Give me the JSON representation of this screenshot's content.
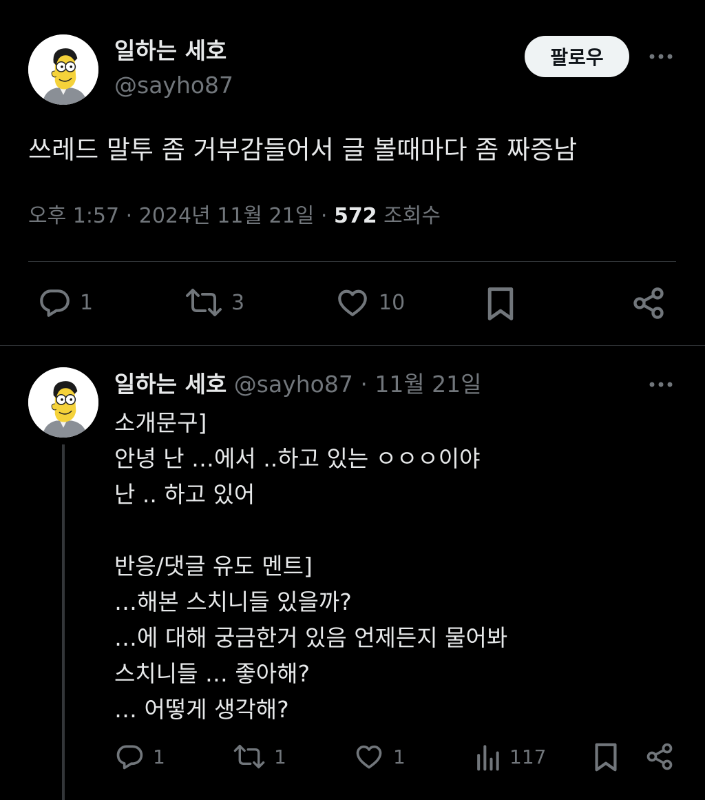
{
  "main_tweet": {
    "author_name": "일하는 세호",
    "author_handle": "@sayho87",
    "follow_label": "팔로우",
    "text": "쓰레드 말투 좀 거부감들어서 글 볼때마다 좀 짜증남",
    "time": "오후 1:57",
    "date": "2024년 11월 21일",
    "separator": "·",
    "views_count": "572",
    "views_label": "조회수",
    "actions": {
      "reply_count": "1",
      "retweet_count": "3",
      "like_count": "10"
    }
  },
  "reply_tweet": {
    "author_name": "일하는 세호",
    "author_handle": "@sayho87",
    "separator": "·",
    "date": "11월 21일",
    "lines": [
      "소개문구]",
      "안녕 난 …에서 ..하고 있는 ㅇㅇㅇ이야",
      "난 ..  하고 있어",
      "",
      "반응/댓글 유도 멘트]",
      "…해본 스치니들 있을까?",
      "…에 대해 궁금한거 있음 언제든지 물어봐",
      "스치니들 … 좋아해?",
      "… 어떻게 생각해?"
    ],
    "actions": {
      "reply_count": "1",
      "retweet_count": "1",
      "like_count": "1",
      "views_count": "117"
    }
  },
  "icons": {
    "reply": "reply-icon",
    "retweet": "retweet-icon",
    "like": "heart-icon",
    "bookmark": "bookmark-icon",
    "share": "share-icon",
    "views": "views-icon",
    "more": "more-icon"
  },
  "colors": {
    "background": "#000000",
    "text_primary": "#e7e9ea",
    "text_secondary": "#71767b",
    "divider": "#2f3336",
    "follow_button_bg": "#eff3f4"
  }
}
